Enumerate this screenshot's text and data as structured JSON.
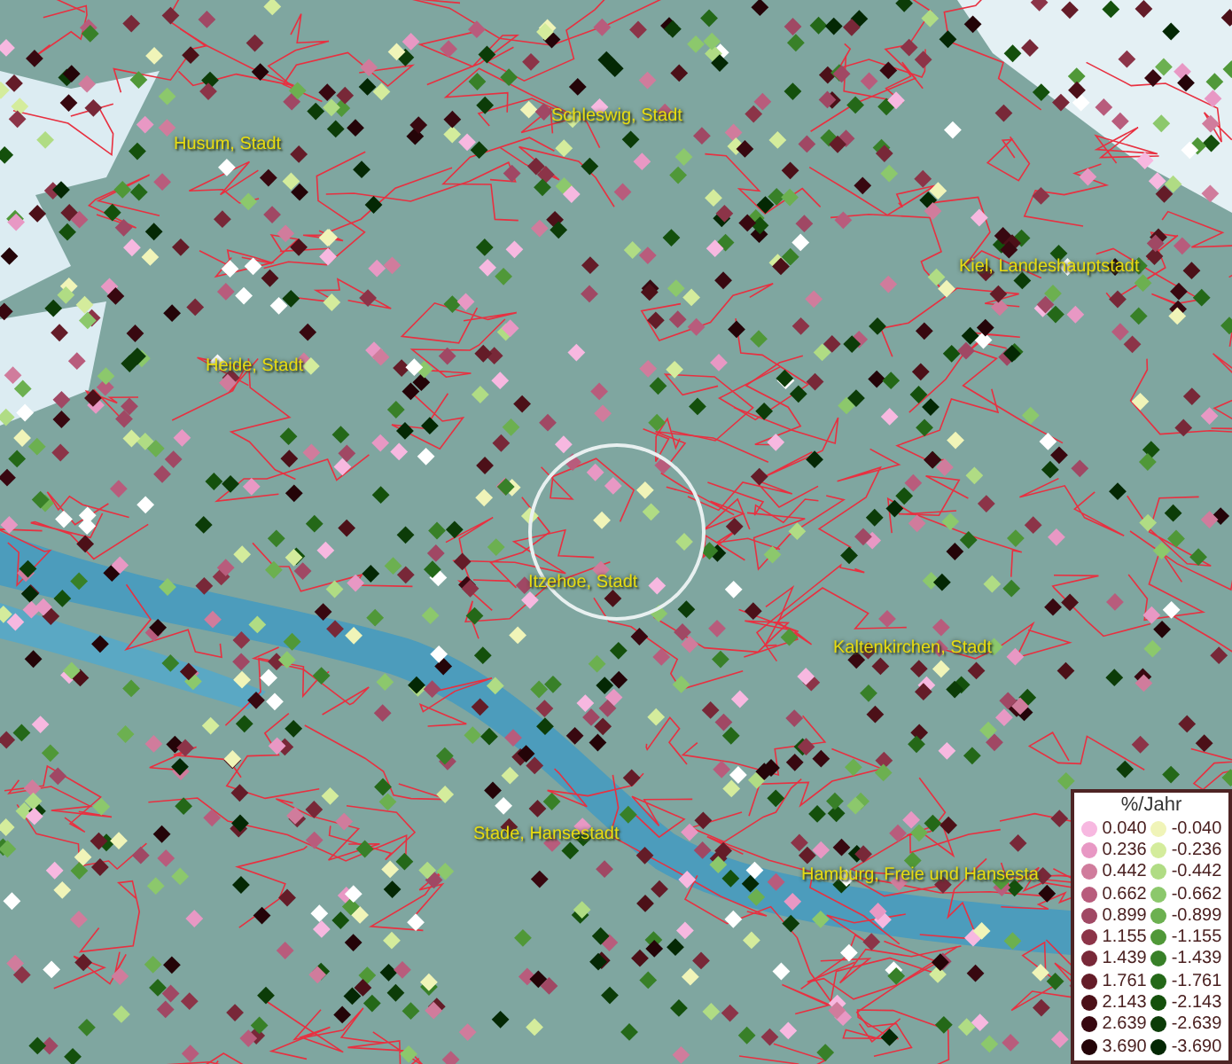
{
  "map": {
    "labels": [
      {
        "text": "Husum, Stadt"
      },
      {
        "text": "Schleswig, Stadt"
      },
      {
        "text": "Kiel, Landeshauptstadt"
      },
      {
        "text": "Heide, Stadt"
      },
      {
        "text": "Itzehoe, Stadt"
      },
      {
        "text": "Kaltenkirchen, Stadt"
      },
      {
        "text": "Stade, Hansestadt"
      },
      {
        "text": "Hamburg, Freie und Hansesta"
      }
    ]
  },
  "legend": {
    "title": "%/Jahr",
    "columns": [
      [
        {
          "label": "0.040",
          "color": "#f7b8e0"
        },
        {
          "label": "0.236",
          "color": "#e898c4"
        },
        {
          "label": "0.442",
          "color": "#d07c9c"
        },
        {
          "label": "0.662",
          "color": "#b85c7c"
        },
        {
          "label": "0.899",
          "color": "#a04864"
        },
        {
          "label": "1.155",
          "color": "#8c3448"
        },
        {
          "label": "1.439",
          "color": "#782838"
        },
        {
          "label": "1.761",
          "color": "#641c28"
        },
        {
          "label": "2.143",
          "color": "#4c1018"
        },
        {
          "label": "2.639",
          "color": "#380810"
        },
        {
          "label": "3.690",
          "color": "#240408"
        }
      ],
      [
        {
          "label": "-0.040",
          "color": "#f0f4b8"
        },
        {
          "label": "-0.236",
          "color": "#d4ec9c"
        },
        {
          "label": "-0.442",
          "color": "#b0dc84"
        },
        {
          "label": "-0.662",
          "color": "#8cc86c"
        },
        {
          "label": "-0.899",
          "color": "#6cb050"
        },
        {
          "label": "-1.155",
          "color": "#509838"
        },
        {
          "label": "-1.439",
          "color": "#388028"
        },
        {
          "label": "-1.761",
          "color": "#246818"
        },
        {
          "label": "-2.143",
          "color": "#14500c"
        },
        {
          "label": "-2.639",
          "color": "#0c3c08"
        },
        {
          "label": "-3.690",
          "color": "#042804"
        }
      ]
    ]
  }
}
